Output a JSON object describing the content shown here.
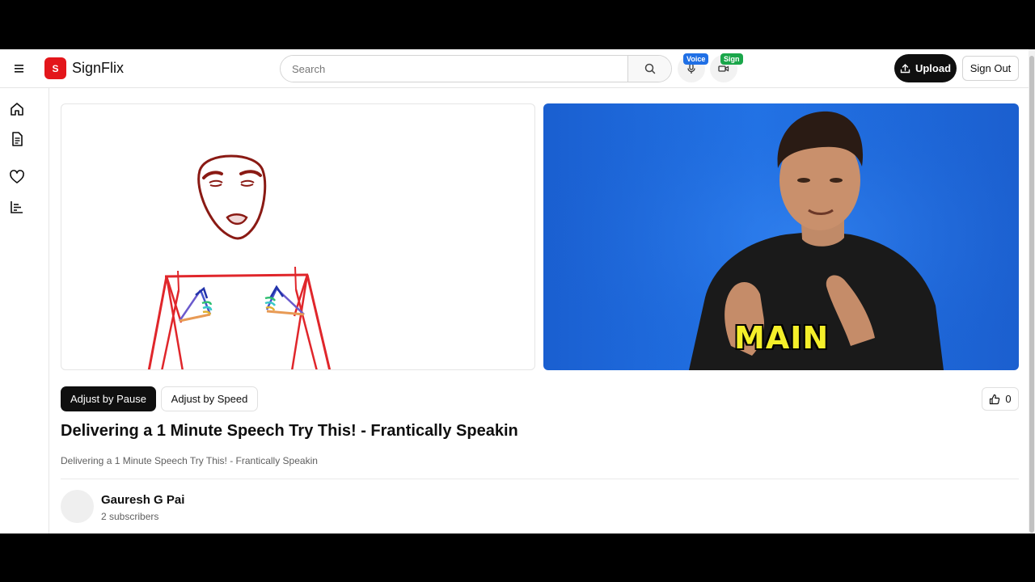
{
  "header": {
    "logo_letter": "S",
    "app_name": "SignFlix",
    "search_placeholder": "Search",
    "voice_badge": "Voice",
    "sign_badge": "Sign",
    "upload_label": "Upload",
    "signout_label": "Sign Out"
  },
  "sidebar": {
    "items": [
      {
        "icon": "home-icon"
      },
      {
        "icon": "document-icon"
      },
      {
        "icon": "heart-icon"
      },
      {
        "icon": "chart-icon"
      }
    ]
  },
  "player": {
    "caption_word": "MAIN"
  },
  "controls": {
    "pause_label": "Adjust by Pause",
    "speed_label": "Adjust by Speed",
    "like_count": "0"
  },
  "video": {
    "title": "Delivering a 1 Minute Speech Try This! - Frantically Speakin",
    "description": "Delivering a 1 Minute Speech Try This! - Frantically Speakin"
  },
  "channel": {
    "name": "Gauresh G Pai",
    "subscribers": "2 subscribers"
  },
  "colors": {
    "brand": "#e3161b",
    "voice_badge": "#1f6fe5",
    "sign_badge": "#1aa64a",
    "dark": "#0f0f0f"
  }
}
